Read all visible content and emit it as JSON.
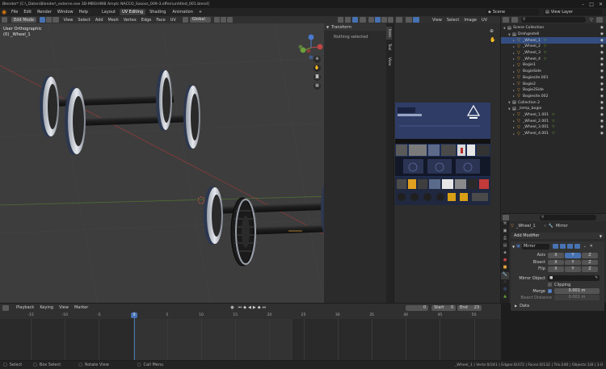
{
  "window": {
    "title": "Blender* [C:\\_Daten\\Blender\\_externe.exe 3D-MBS\\HWB Amytc NACCO_Sasoss_009-3.offen\\untitled_001.blend]"
  },
  "menubar": {
    "items": [
      "File",
      "Edit",
      "Render",
      "Window",
      "Help"
    ],
    "workspaces": [
      "Layout",
      "UV Editing",
      "Shading",
      "Animation"
    ],
    "active_workspace": "UV Editing",
    "add_tab": "+",
    "scene_label": "Scene",
    "view_layer_label": "View Layer"
  },
  "viewport_header": {
    "mode": "Edit Mode",
    "menus": [
      "View",
      "Select",
      "Add",
      "Mesh",
      "Vertex",
      "Edge",
      "Face",
      "UV"
    ],
    "orientation": "Global"
  },
  "viewport": {
    "view_name": "User Orthographic",
    "object_name": "(0) _Wheel_1",
    "n_panel": {
      "title": "Transform",
      "empty_msg": "Nothing selected",
      "tabs": [
        "Item",
        "Tool",
        "View"
      ]
    }
  },
  "uv_header": {
    "menus": [
      "View",
      "Select",
      "Image",
      "UV"
    ]
  },
  "outliner": {
    "search_placeholder": "",
    "items": [
      {
        "label": "Scene Collection",
        "depth": 0,
        "type": "collection"
      },
      {
        "label": "Drehgestell",
        "depth": 1,
        "type": "collection"
      },
      {
        "label": "_Wheel_1",
        "depth": 2,
        "type": "mesh",
        "selected": true
      },
      {
        "label": "_Wheel_2",
        "depth": 2,
        "type": "mesh"
      },
      {
        "label": "_Wheel_3",
        "depth": 2,
        "type": "mesh"
      },
      {
        "label": "_Wheel_4",
        "depth": 2,
        "type": "mesh"
      },
      {
        "label": "Bogie1",
        "depth": 2,
        "type": "mesh"
      },
      {
        "label": "BogieSide",
        "depth": 2,
        "type": "mesh"
      },
      {
        "label": "Bogiesite.001",
        "depth": 2,
        "type": "mesh"
      },
      {
        "label": "Bogie2",
        "depth": 2,
        "type": "mesh"
      },
      {
        "label": "Bogie2Side",
        "depth": 2,
        "type": "mesh"
      },
      {
        "label": "Bogiesite.002",
        "depth": 2,
        "type": "mesh"
      },
      {
        "label": "Collection 2",
        "depth": 1,
        "type": "collection"
      },
      {
        "label": "_temp_bogie",
        "depth": 1,
        "type": "collection"
      },
      {
        "label": "_Wheel_1.001",
        "depth": 2,
        "type": "mesh"
      },
      {
        "label": "_Wheel_2.001",
        "depth": 2,
        "type": "mesh"
      },
      {
        "label": "_Wheel_3.001",
        "depth": 2,
        "type": "mesh"
      },
      {
        "label": "_Wheel_4.001",
        "depth": 2,
        "type": "mesh"
      }
    ]
  },
  "properties": {
    "object_name": "_Wheel_1",
    "modifier_name_field": "Mirror",
    "add_modifier": "Add Modifier",
    "modifier_card_name": "Mirror",
    "axis_rows": [
      {
        "label": "Axis",
        "buttons": [
          "X",
          "Y",
          "Z"
        ],
        "active": [
          false,
          true,
          false
        ]
      },
      {
        "label": "Bisect",
        "buttons": [
          "X",
          "Y",
          "Z"
        ],
        "active": [
          false,
          false,
          false
        ]
      },
      {
        "label": "Flip",
        "buttons": [
          "X",
          "Y",
          "Z"
        ],
        "active": [
          false,
          false,
          false
        ]
      }
    ],
    "mirror_object_label": "Mirror Object",
    "clipping_label": "Clipping",
    "merge_label": "Merge",
    "merge_value": "0.001 m",
    "bisect_distance_label": "Bisect Distance",
    "bisect_distance_value": "0.001 m",
    "data_section": "Data"
  },
  "timeline": {
    "menus": [
      "Playback",
      "Keying",
      "View",
      "Marker"
    ],
    "current_frame": "0",
    "start_label": "Start",
    "start_value": "0",
    "end_label": "End",
    "end_value": "23",
    "ruler": [
      "-15",
      "-10",
      "-5",
      "0",
      "5",
      "10",
      "15",
      "20",
      "25",
      "30",
      "35",
      "40",
      "45",
      "50"
    ],
    "playhead_label": "0"
  },
  "statusbar": {
    "items": [
      "Select",
      "Box Select",
      "Rotate View",
      "Call Menu"
    ],
    "stats": "_Wheel_1 | Verts:0/241 | Edges:0/372 | Faces:0/132 | Tris:240 | Objects:1/8 | 3.0"
  },
  "colors": {
    "accent": "#4772b3",
    "selected_row": "#334d80",
    "viewport_bg": "#3d3d3d",
    "panel_bg": "#303030",
    "axis_x": "#c24545",
    "axis_y": "#6ca03a",
    "axis_z": "#4a7ad0"
  }
}
